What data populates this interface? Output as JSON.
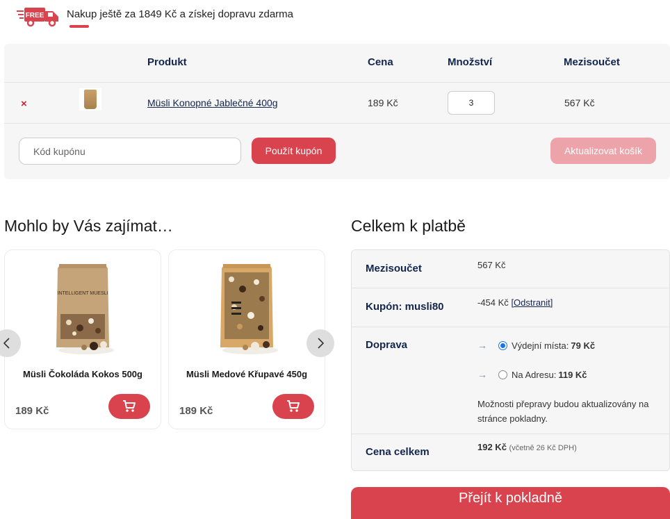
{
  "banner": {
    "badge": "FREE",
    "text": "Nakup ještě za 1849 Kč a získej dopravu zdarma"
  },
  "cart": {
    "headers": {
      "product": "Produkt",
      "price": "Cena",
      "quantity": "Množství",
      "subtotal": "Mezisoučet"
    },
    "item": {
      "remove": "×",
      "name": "Müsli Konopné Jablečné 400g",
      "price": "189 Kč",
      "quantity": "3",
      "subtotal": "567 Kč"
    },
    "coupon_placeholder": "Kód kupónu",
    "apply_label": "Použít kupón",
    "update_label": "Aktualizovat košík"
  },
  "recommended": {
    "title": "Mohlo by Vás zajímat…",
    "products": [
      {
        "name": "Müsli Čokoláda Kokos 500g",
        "price": "189 Kč",
        "package_text": "INTELLIGENT MUESLI"
      },
      {
        "name": "Müsli Medové Křupavé 450g",
        "price": "189 Kč"
      }
    ]
  },
  "totals": {
    "title": "Celkem k platbě",
    "subtotal_label": "Mezisoučet",
    "subtotal_value": "567 Kč",
    "coupon_label": "Kupón: musli80",
    "coupon_value": "-454 Kč",
    "coupon_remove": "[Odstranit]",
    "shipping_label": "Doprava",
    "shipping_options": [
      {
        "label": "Výdejní místa: ",
        "price": "79 Kč",
        "selected": true
      },
      {
        "label": "Na Adresu: ",
        "price": "119 Kč",
        "selected": false
      }
    ],
    "shipping_note": "Možnosti přepravy budou aktualizovány na stránce pokladny.",
    "total_label": "Cena celkem",
    "total_value": "192 Kč",
    "total_tax": "(včetně 26 Kč DPH)"
  },
  "checkout_label": "Přejít k pokladně",
  "colors": {
    "accent": "#d9434e",
    "accent_disabled": "#eca4aa",
    "heading": "#12254d",
    "panel": "#f6f6f6"
  }
}
